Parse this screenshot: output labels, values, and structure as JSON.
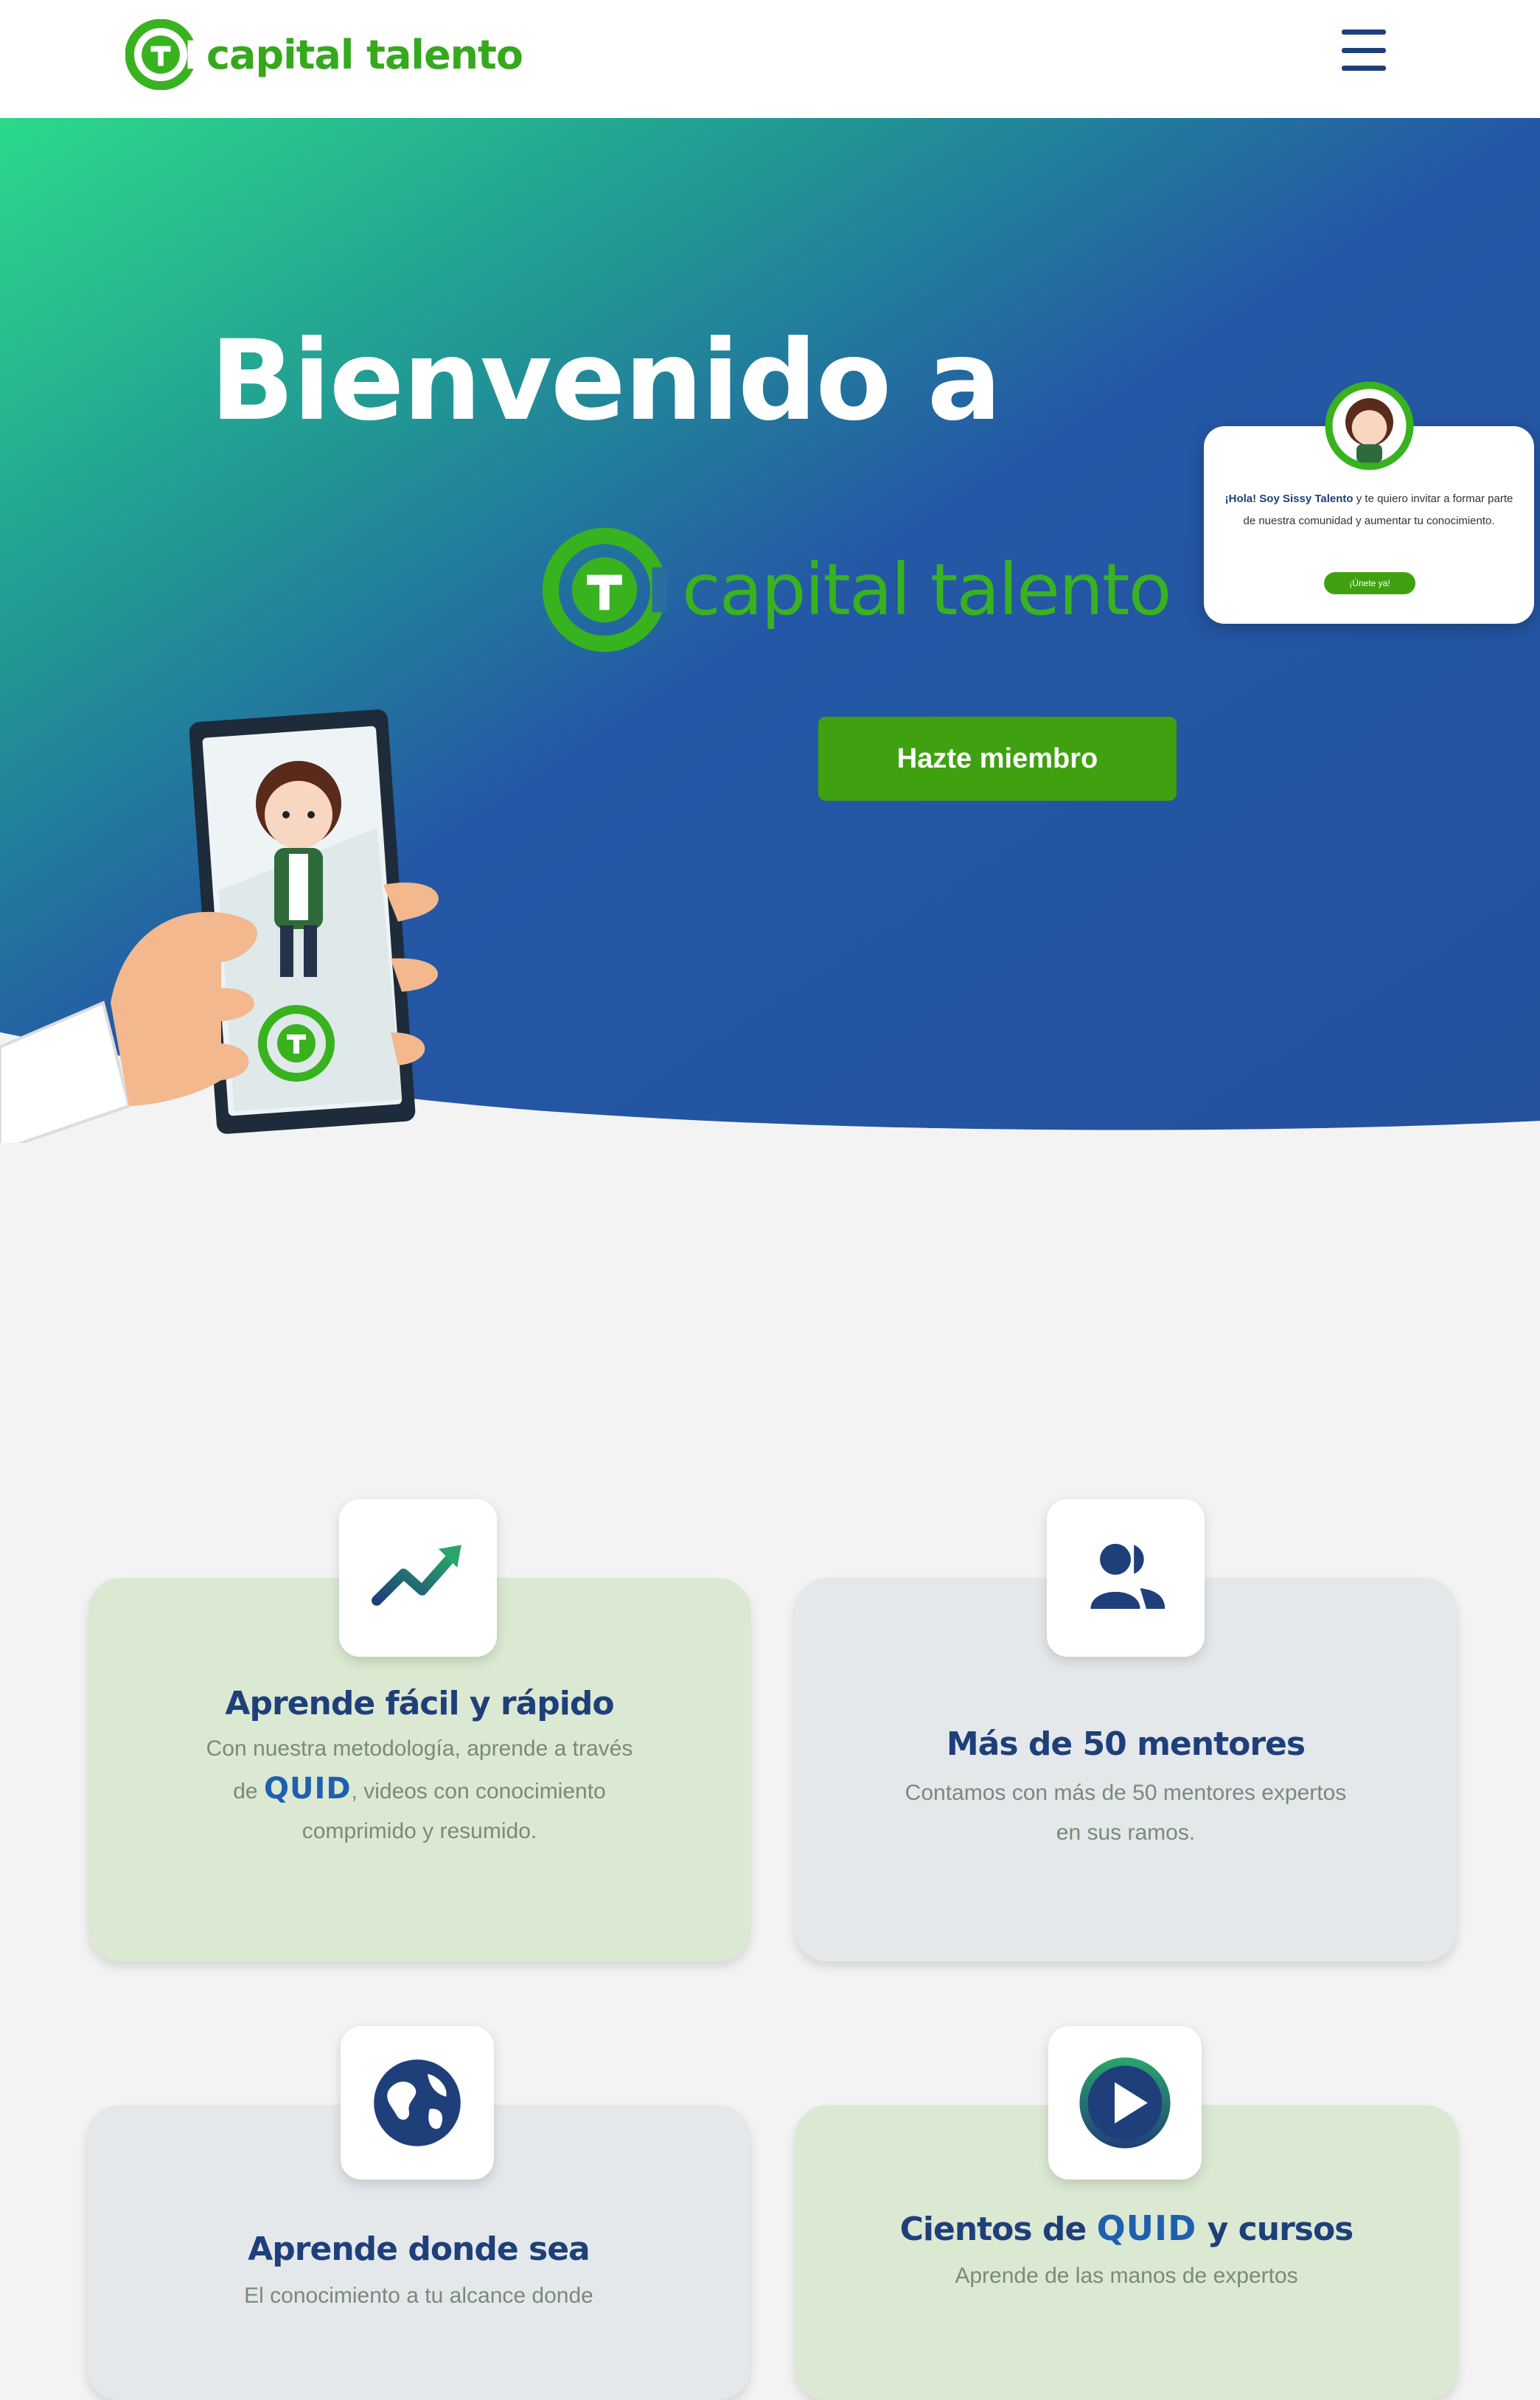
{
  "header": {
    "logo_text": "capital talento",
    "menu_icon": "hamburger-icon"
  },
  "hero": {
    "title": "Bienvenido a",
    "logo_text": "capital talento",
    "cta_label": "Hazte miembro",
    "chat": {
      "greeting": "¡Hola! Soy Sissy Talento",
      "text": " y te quiero invitar a formar parte de nuestra comunidad y aumentar tu conocimiento.",
      "button_label": "¡Únete ya!"
    }
  },
  "features": [
    {
      "icon": "trending-up-icon",
      "title": "Aprende fácil y rápido",
      "desc_before": "Con nuestra metodología, aprende a través de ",
      "brand": "QUID",
      "desc_after": ", videos con conocimiento comprimido y resumido."
    },
    {
      "icon": "mentors-icon",
      "title": "Más de 50 mentores",
      "desc": "Contamos con más de 50 mentores expertos en sus ramos."
    },
    {
      "icon": "globe-icon",
      "title": "Aprende donde sea",
      "desc": "El conocimiento a tu alcance donde"
    },
    {
      "icon": "play-icon",
      "title_before": "Cientos de ",
      "brand": "QUID",
      "title_after": " y cursos",
      "desc": "Aprende de las manos de expertos"
    }
  ],
  "colors": {
    "brand_green": "#3fa10f",
    "brand_navy": "#1f3f7a",
    "hero_start": "#2bd98a",
    "hero_end": "#2458a6",
    "card_green": "#dbe9d2",
    "card_grey": "#e4e8eb"
  }
}
